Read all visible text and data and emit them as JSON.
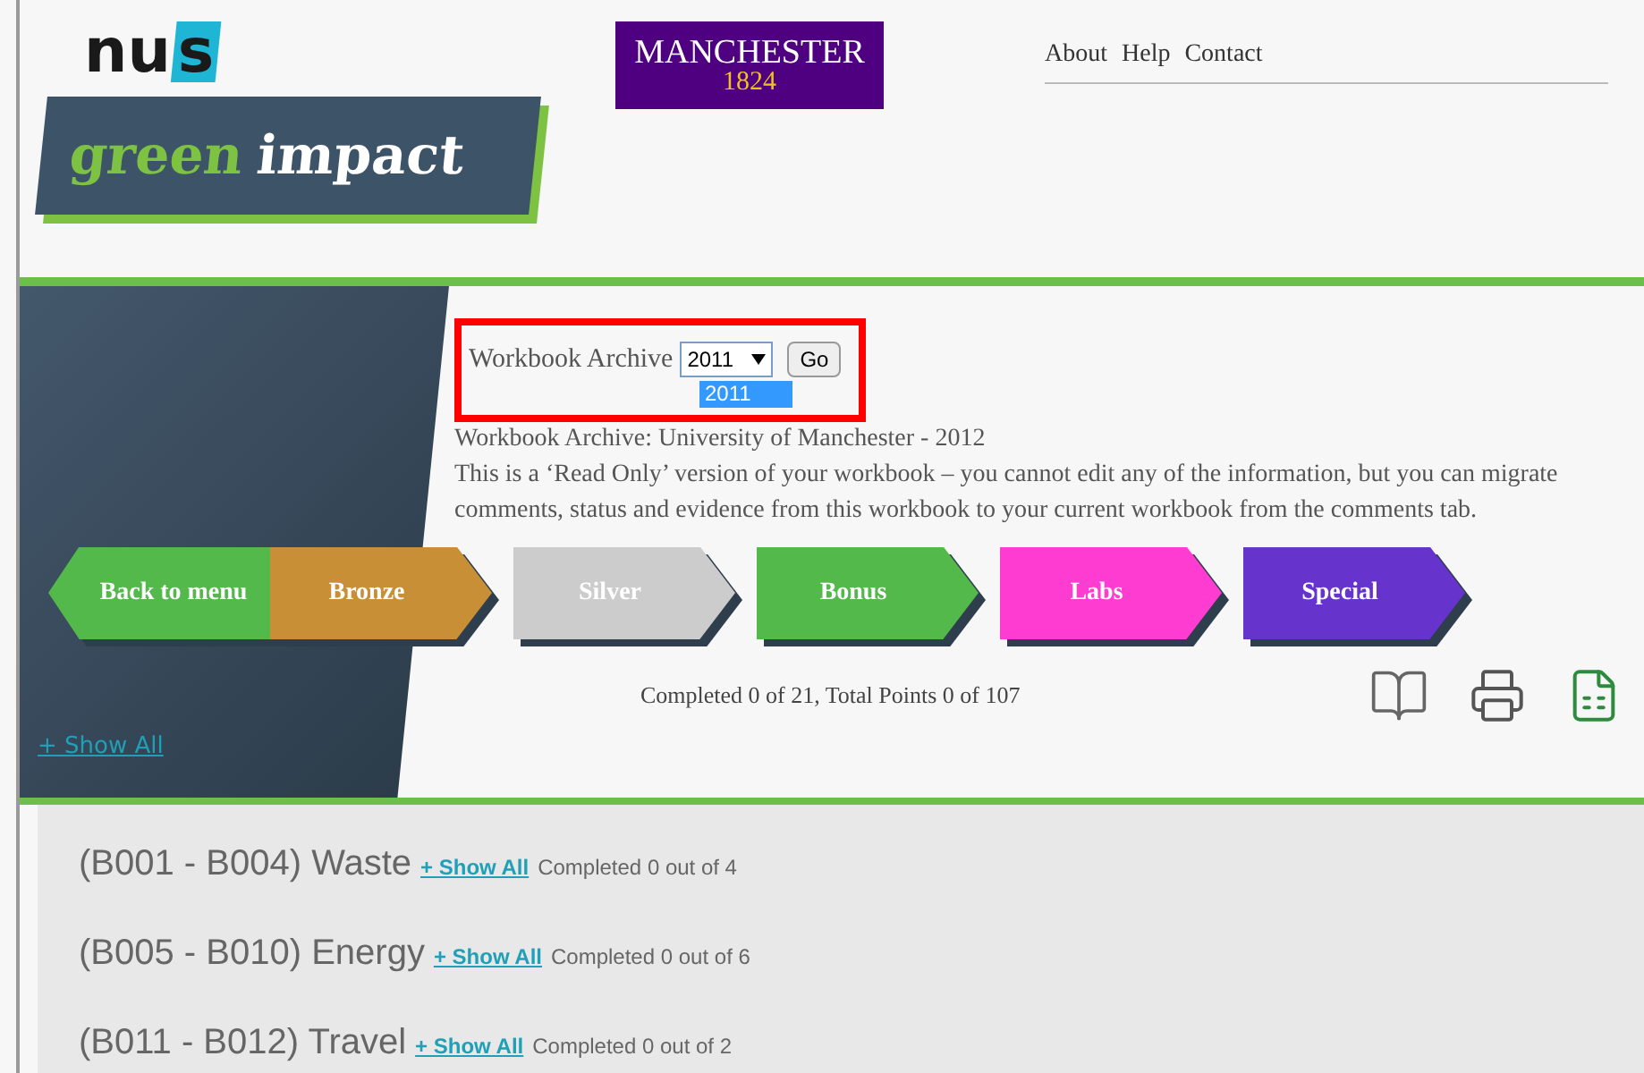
{
  "logos": {
    "nus": "nu",
    "nus_s": "s",
    "green": "green",
    "impact": "impact",
    "university": "MANCHESTER",
    "year": "1824"
  },
  "nav": [
    "About",
    "Help",
    "Contact"
  ],
  "archive": {
    "label": "Workbook Archive",
    "value": "2011",
    "options": [
      {
        "label": "2011",
        "selected": true
      }
    ],
    "button": "Go",
    "highlighted": true
  },
  "archive_title": "Workbook Archive: University of Manchester - 2012",
  "notice": "This is a ‘Read Only’ version of your workbook – you cannot edit any of the information, but you can migrate comments, status and evidence from this workbook to your current workbook from the comments tab.",
  "levels": [
    {
      "label": "Back to menu",
      "kind": "back",
      "color": "#52b94a"
    },
    {
      "label": "Bronze",
      "kind": "level",
      "color": "#c98f37"
    },
    {
      "label": "Silver",
      "kind": "level",
      "color": "#cccccc"
    },
    {
      "label": "Bonus",
      "kind": "level",
      "color": "#52b94a"
    },
    {
      "label": "Labs",
      "kind": "level",
      "color": "#ff3cd2"
    },
    {
      "label": "Special",
      "kind": "level",
      "color": "#6633cc"
    }
  ],
  "progress": "Completed 0 of 21, Total Points 0 of 107",
  "show_all": "+ Show All",
  "categories": [
    {
      "title": "(B001 - B004) Waste",
      "link": "+ Show All",
      "status": "Completed 0 out of 4"
    },
    {
      "title": "(B005 - B010) Energy",
      "link": "+ Show All",
      "status": "Completed 0 out of 6"
    },
    {
      "title": "(B011 - B012) Travel",
      "link": "+ Show All",
      "status": "Completed 0 out of 2"
    }
  ]
}
